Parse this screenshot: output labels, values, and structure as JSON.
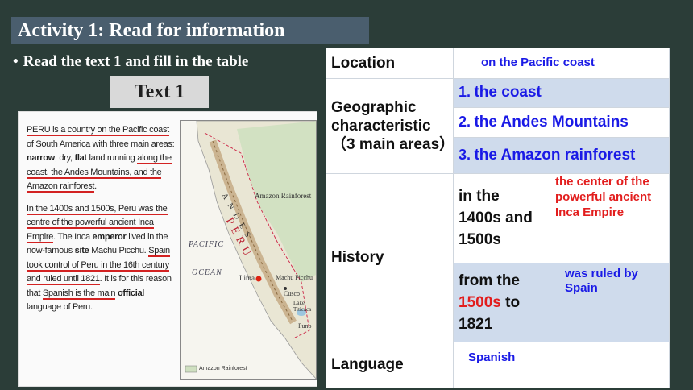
{
  "slide": {
    "title": "Activity 1: Read for information",
    "instruction": "Read the text 1 and fill in the table",
    "text_label": "Text 1"
  },
  "passage": {
    "p1": {
      "u1": "PERU is a country on the Pacific coast",
      "t1": " of South America with three main areas: ",
      "b1": "narrow",
      "t2": ", dry, ",
      "b2": "flat",
      "t3": " land running ",
      "u2": "along the coast, the Andes Mountains, and the Amazon rainforest",
      "t4": "."
    },
    "p2": {
      "u1": "In the 1400s and 1500s, Peru was the centre of the powerful ancient Inca Empire",
      "t1": ". The Inca ",
      "b1": "emperor",
      "t2": " lived in the now-famous ",
      "b2": "site",
      "t3": " Machu Picchu. ",
      "u2": "Spain took control of Peru in the 16th century and ruled until 1821",
      "t4": ". It is for this reason that ",
      "u3": "Spanish is the main",
      "t5": " ",
      "b3": "official",
      "t6": " language of Peru."
    }
  },
  "map": {
    "labels": {
      "pacific": "PACIFIC",
      "ocean": "OCEAN",
      "amazon": "Amazon Rainforest",
      "lima": "Lima",
      "machu": "Machu Picchu",
      "cusco": "Cusco",
      "lake": "Lake Titicaca",
      "puno": "Puno",
      "legend": "Amazon Rainforest",
      "peru": "PERU",
      "andes": "ANDES"
    }
  },
  "table": {
    "location_label": "Location",
    "location_value": "on the Pacific coast",
    "geo_label": "Geographic characteristic （3 main areas）",
    "geo_items": [
      {
        "num": "1.",
        "text": "the coast"
      },
      {
        "num": "2.",
        "text": "the Andes Mountains"
      },
      {
        "num": "3.",
        "text": "the Amazon rainforest"
      }
    ],
    "history_label": "History",
    "history_rows": [
      {
        "period": "in the 1400s and 1500s",
        "event": "the center of the powerful ancient Inca Empire"
      },
      {
        "period_pre": "from the",
        "period_red": "1500s",
        "period_post": " to 1821",
        "event": "was ruled by Spain"
      }
    ],
    "language_label": "Language",
    "language_value": "Spanish"
  },
  "colors": {
    "background": "#2b3d38",
    "title_bar": "#4a5e6e",
    "answer_blue": "#1a1ae6",
    "answer_red": "#e21d1d",
    "row_blue": "#cfdbec"
  }
}
